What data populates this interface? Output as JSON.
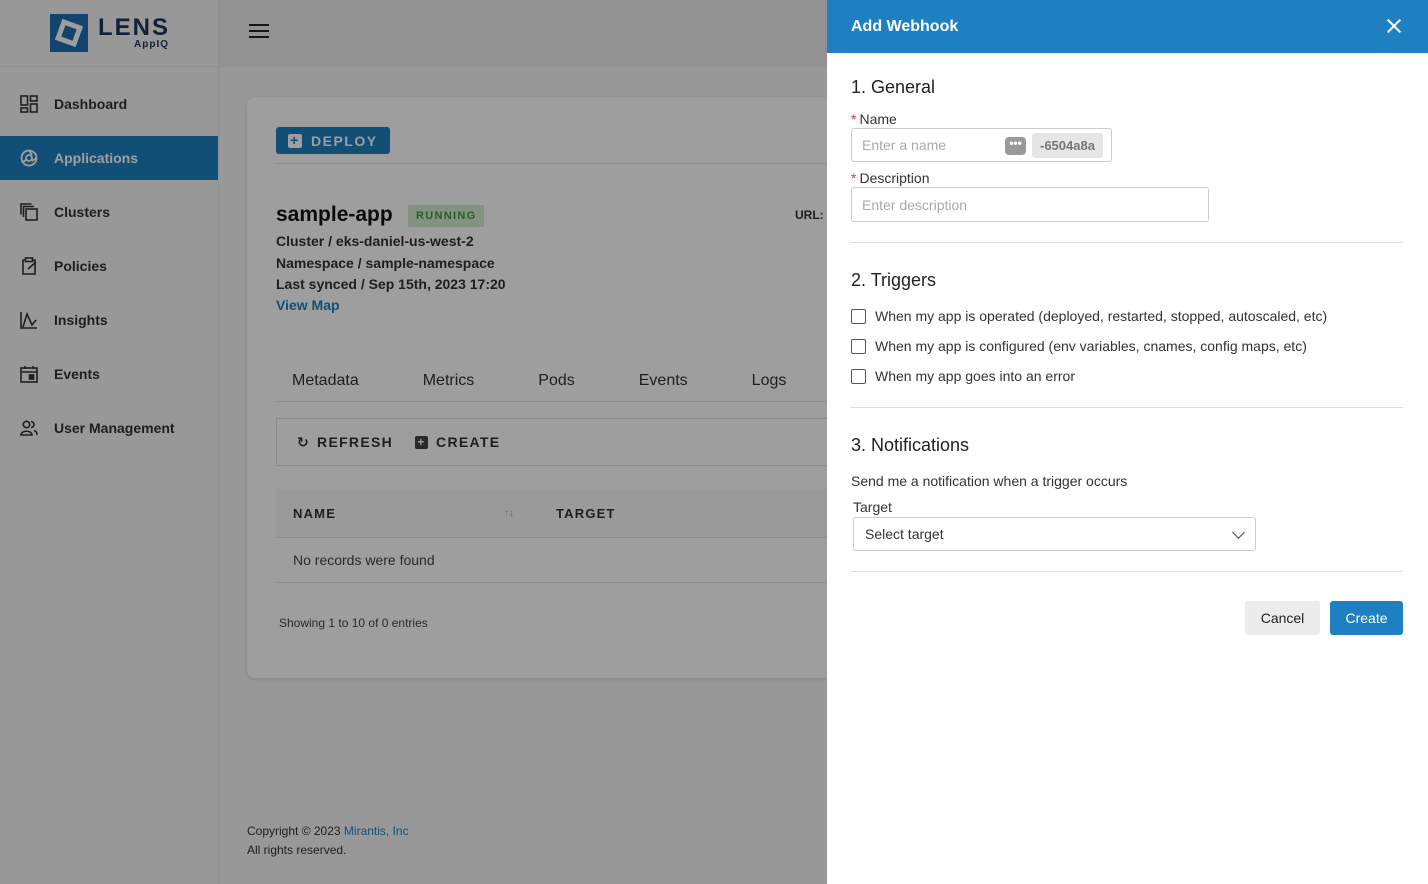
{
  "brand": {
    "title": "LENS",
    "subtitle": "AppIQ"
  },
  "sidebar": {
    "items": [
      {
        "label": "Dashboard",
        "icon": "dashboard-icon"
      },
      {
        "label": "Applications",
        "icon": "applications-icon",
        "active": true
      },
      {
        "label": "Clusters",
        "icon": "clusters-icon"
      },
      {
        "label": "Policies",
        "icon": "policies-icon"
      },
      {
        "label": "Insights",
        "icon": "insights-icon"
      },
      {
        "label": "Events",
        "icon": "events-icon"
      },
      {
        "label": "User Management",
        "icon": "users-icon"
      }
    ]
  },
  "main": {
    "deploy_label": "DEPLOY",
    "app_name": "sample-app",
    "status": "RUNNING",
    "cluster": "Cluster / eks-daniel-us-west-2",
    "namespace": "Namespace / sample-namespace",
    "last_synced": "Last synced / Sep 15th, 2023 17:20",
    "view_map": "View Map",
    "url_label": "URL:",
    "tabs": [
      "Metadata",
      "Metrics",
      "Pods",
      "Events",
      "Logs"
    ],
    "toolbar": {
      "refresh": "REFRESH",
      "create": "CREATE"
    },
    "table": {
      "columns": [
        "NAME",
        "TARGET"
      ],
      "sort_glyph": "↑↓",
      "empty": "No records were found"
    },
    "entries": "Showing 1 to 10 of 0 entries"
  },
  "footer": {
    "copyright": "Copyright © 2023 ",
    "company": "Mirantis, Inc",
    "rights": "All rights reserved."
  },
  "drawer": {
    "title": "Add Webhook",
    "general": {
      "title": "1. General",
      "name_label": "Name",
      "name_placeholder": "Enter a name",
      "name_suffix": "-6504a8a",
      "description_label": "Description",
      "description_placeholder": "Enter description"
    },
    "triggers": {
      "title": "2. Triggers",
      "options": [
        "When my app is operated (deployed, restarted, stopped, autoscaled, etc)",
        "When my app is configured (env variables, cnames, config maps, etc)",
        "When my app goes into an error"
      ]
    },
    "notifications": {
      "title": "3. Notifications",
      "text": "Send me a notification when a trigger occurs",
      "target_label": "Target",
      "target_value": "Select target"
    },
    "cancel": "Cancel",
    "create": "Create"
  }
}
